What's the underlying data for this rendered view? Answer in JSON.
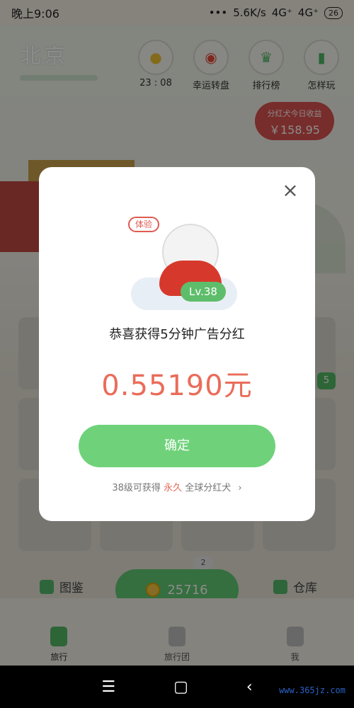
{
  "status_bar": {
    "time": "晚上9:06",
    "dots": "•••",
    "network_speed": "5.6K/s",
    "signal_1": "4G⁺",
    "signal_2": "4G⁺",
    "battery": "26"
  },
  "scene": {
    "city": "北京",
    "timer": "23 : 08",
    "icons": [
      {
        "label": "幸运转盘",
        "icon": "wheel-icon"
      },
      {
        "label": "排行榜",
        "icon": "trophy-icon"
      },
      {
        "label": "怎样玩",
        "icon": "book-icon"
      }
    ],
    "earn_title": "分红犬今日收益",
    "earn_value": "￥158.95",
    "badge_value": "5"
  },
  "bottom_actions": {
    "left_label": "图鉴",
    "right_label": "仓库",
    "coin_value": "25716",
    "coin_count": "2"
  },
  "tabs": [
    {
      "label": "旅行",
      "active": true
    },
    {
      "label": "旅行团",
      "active": false
    },
    {
      "label": "我",
      "active": false
    }
  ],
  "system_nav": {
    "menu": "☰",
    "home": "▢",
    "back": "‹"
  },
  "watermark": "www.365jz.com",
  "modal": {
    "trial_badge": "体验",
    "level": "Lv.38",
    "title": "恭喜获得5分钟广告分红",
    "amount": "0.55190元",
    "confirm_label": "确定",
    "hint_prefix": "38级可获得",
    "hint_emphasis": "永久",
    "hint_suffix": "全球分红犬",
    "hint_arrow": "›"
  }
}
